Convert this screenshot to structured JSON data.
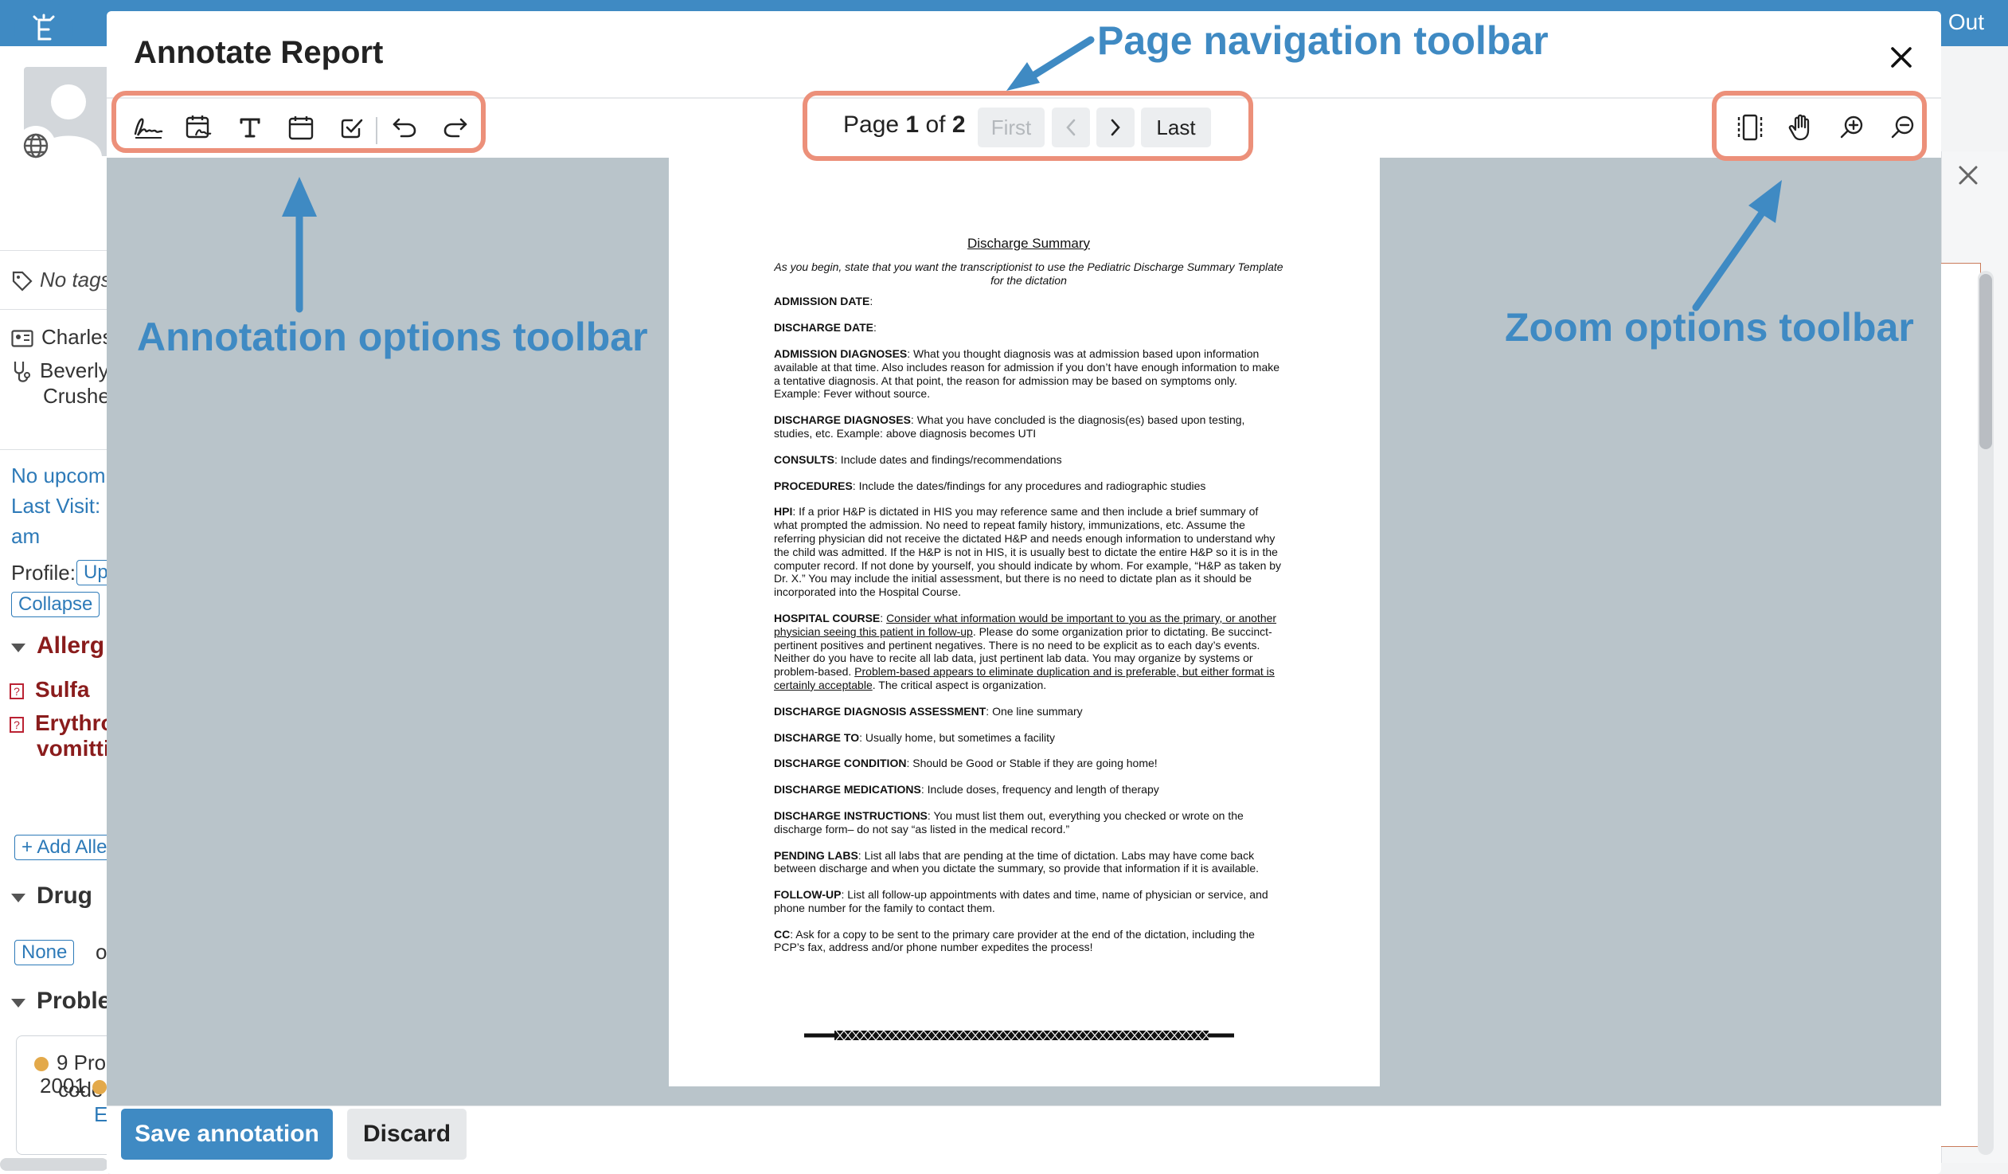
{
  "app": {
    "sign_out": "Out"
  },
  "sidebar": {
    "tags": "No tags",
    "people": [
      "Charles",
      "Beverly",
      "Crushe"
    ],
    "appointments": "No upcom",
    "last_visit": "Last Visit:",
    "last_visit_suffix": "am",
    "profile_label": "Profile:",
    "profile_button": "Up",
    "collapse_button": "Collapse",
    "allergies_heading": "Allerg",
    "allergies": [
      "Sulfa",
      "Erythro",
      "vomittin"
    ],
    "add_allergy": "+ Add Alle",
    "drug_heading": "Drug",
    "drug_none": "None",
    "drug_extra": "o",
    "problems_heading": "Proble",
    "problem_count": "9 Pro",
    "problem_code": "code",
    "problem_year": "2001",
    "problem_link": "E"
  },
  "modal": {
    "title": "Annotate Report",
    "pager": {
      "prefix": "Page",
      "current": "1",
      "sep": "of",
      "total": "2",
      "first": "First",
      "last": "Last"
    },
    "annotation_tools": [
      "signature-icon",
      "date-signature-icon",
      "text-icon",
      "calendar-icon",
      "checkbox-icon",
      "undo-icon",
      "redo-icon"
    ],
    "zoom_tools": [
      "fit-page-icon",
      "pan-hand-icon",
      "zoom-in-icon",
      "zoom-out-icon"
    ],
    "save_label": "Save annotation",
    "discard_label": "Discard"
  },
  "document": {
    "title": "Discharge Summary",
    "instruction": "As you begin, state that you want the transcriptionist to use the Pediatric Discharge Summary Template for the dictation",
    "sections": [
      {
        "head": "ADMISSION DATE",
        "text": ""
      },
      {
        "head": "DISCHARGE DATE",
        "text": ""
      },
      {
        "head": "ADMISSION DIAGNOSES",
        "text": "What you thought diagnosis was at admission based upon information available at that time.  Also includes reason for admission if you don’t have enough information to make a tentative diagnosis.   At that point, the reason for admission may be based on symptoms only.  Example:  Fever without source."
      },
      {
        "head": "DISCHARGE DIAGNOSES",
        "text": "What you have concluded is the diagnosis(es) based upon testing, studies, etc.  Example:  above diagnosis becomes UTI"
      },
      {
        "head": "CONSULTS",
        "text": "Include dates and findings/recommendations"
      },
      {
        "head": "PROCEDURES",
        "text": "Include the dates/findings for any procedures and radiographic studies"
      },
      {
        "head": "HPI",
        "text": "If a prior H&P is dictated in HIS you may reference same and then include a brief summary of what prompted the admission.  No need to repeat family history, immunizations, etc.  Assume the referring physician did not receive the dictated H&P and needs enough information to understand why the child was admitted. If the H&P is not in HIS, it is usually best to dictate the entire H&P so it is in the computer record.  If not done by yourself, you should indicate by whom. For example, “H&P as taken by Dr. X.”  You may include the initial assessment, but there is no need to dictate plan as it should be incorporated into the Hospital Course."
      },
      {
        "head": "DISCHARGE DIAGNOSIS ASSESSMENT",
        "text": "One line summary"
      },
      {
        "head": "DISCHARGE TO",
        "text": "Usually home, but sometimes a facility"
      },
      {
        "head": "DISCHARGE CONDITION",
        "text": "Should be Good or Stable if they are going home!"
      },
      {
        "head": "DISCHARGE MEDICATIONS",
        "text": "Include doses, frequency and length of therapy"
      },
      {
        "head": "DISCHARGE INSTRUCTIONS",
        "text": "You must list them out, everything you checked or wrote on the discharge form– do not say “as listed in the medical record.”"
      },
      {
        "head": "PENDING LABS",
        "text": "List all labs that are pending at the time of dictation.  Labs may have come back between discharge and when you dictate the summary, so provide that information if it is available."
      },
      {
        "head": "FOLLOW-UP",
        "text": "List all follow-up appointments with dates and time, name of physician or service, and phone number for the family to contact them."
      },
      {
        "head": "CC",
        "text": "Ask for a copy to be sent to the primary care provider at the end of the dictation, including the PCP’s fax, address and/or phone number expedites the process!"
      }
    ],
    "hospital_course": {
      "head": "HOSPITAL COURSE",
      "u1": "Consider what information would be important to you as the primary, or another physician seeing this patient in follow-up",
      "mid": ".  Please do some organization prior to dictating.  Be succinct-pertinent positives and pertinent negatives.  There is no need to be explicit as to each day’s events.  Neither do you have to recite all lab data, just pertinent lab data.  You may organize by systems or problem-based.  ",
      "u2": "Problem-based appears to eliminate duplication and is preferable, but either format is certainly acceptable",
      "end": ".  The critical aspect is organization."
    }
  },
  "callouts": {
    "page_nav": "Page navigation toolbar",
    "annotation": "Annotation options toolbar",
    "zoom": "Zoom options toolbar"
  },
  "colors": {
    "accent": "#3f8ac3",
    "highlight": "#ec907a",
    "viewer_bg": "#b9c4ca",
    "allergy_red": "#8a1c1c"
  }
}
